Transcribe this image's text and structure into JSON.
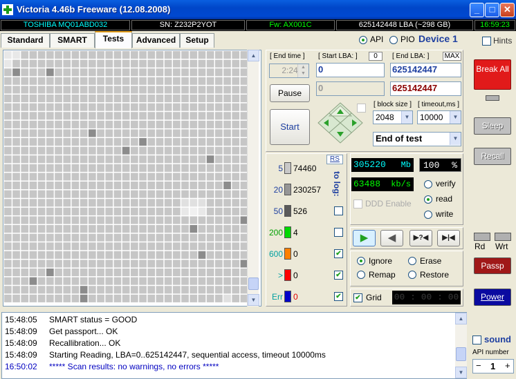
{
  "window": {
    "title": "Victoria 4.46b Freeware (12.08.2008)",
    "controls": {
      "minimize": "_",
      "maximize": "□",
      "close": "✕"
    }
  },
  "infobar": {
    "model": "TOSHIBA MQ01ABD032",
    "serial": "SN: Z232P2YOT",
    "firmware": "Fw: AX001C",
    "capacity": "625142448 LBA (~298 GB)",
    "clock": "16:59:23"
  },
  "tabs": [
    {
      "label": "Standard"
    },
    {
      "label": "SMART"
    },
    {
      "label": "Tests",
      "active": true
    },
    {
      "label": "Advanced"
    },
    {
      "label": "Setup"
    }
  ],
  "mode": {
    "api_label": "API",
    "pio_label": "PIO",
    "api_selected": true,
    "device_label": "Device 1",
    "hints_label": "Hints"
  },
  "test": {
    "end_time_label": "[ End time ]",
    "end_time_value": "2:24",
    "start_lba_label": "[ Start LBA: ]",
    "start_lba_zero": "0",
    "start_lba_value": "0",
    "end_lba_label": "[ End LBA: ]",
    "end_lba_max": "MAX",
    "end_lba_value": "625142447",
    "current_lba_value": "625142447",
    "pause_lba_value": "0",
    "pause_label": "Pause",
    "start_label": "Start",
    "block_size_label": "[ block size ]",
    "block_size_value": "2048",
    "timeout_label": "[ timeout,ms ]",
    "timeout_value": "10000",
    "end_action_value": "End of test"
  },
  "blocks": {
    "rs_label": "RS",
    "to_log_label": "to log:",
    "rows": [
      {
        "threshold": "5",
        "count": "74460",
        "color": "#c8c8c8",
        "log": null
      },
      {
        "threshold": "20",
        "count": "230257",
        "color": "#969696",
        "log": null
      },
      {
        "threshold": "50",
        "count": "526",
        "color": "#5a5a5a",
        "log": false
      },
      {
        "threshold": "200",
        "count": "4",
        "color": "#00d800",
        "log": false
      },
      {
        "threshold": "600",
        "count": "0",
        "color": "#ff8000",
        "log": true
      },
      {
        "threshold": ">",
        "count": "0",
        "color": "#ff0000",
        "log": true
      },
      {
        "threshold": "Err",
        "count": "0",
        "color": "#0000c8",
        "log": true
      }
    ]
  },
  "stats": {
    "mb_value": "305220",
    "mb_unit": "Mb",
    "percent_value": "100",
    "percent_unit": "%",
    "speed_value": "63488",
    "speed_unit": "kb/s",
    "ddd_label": "DDD Enable",
    "verify_label": "verify",
    "read_label": "read",
    "write_label": "write",
    "selected_mode": "read"
  },
  "playback": {
    "play": "▶",
    "back": "◀",
    "skip_unknown": "▶?◀",
    "skip_end": "▶|◀"
  },
  "repair": {
    "ignore_label": "Ignore",
    "erase_label": "Erase",
    "remap_label": "Remap",
    "restore_label": "Restore",
    "selected": "Ignore",
    "grid_label": "Grid",
    "grid_checked": true,
    "timer": "00 : 00 : 00"
  },
  "right": {
    "break_label": "Break All",
    "sleep_label": "Sleep",
    "recall_label": "Recall",
    "rd_label": "Rd",
    "wrt_label": "Wrt",
    "passp_label": "Passp",
    "power_label": "Power",
    "sound_label": "sound",
    "api_number_label": "API number",
    "api_number_value": "1",
    "minus": "−",
    "plus": "+"
  },
  "log": [
    {
      "time": "15:48:05",
      "text": "SMART status = GOOD",
      "color": "#000000"
    },
    {
      "time": "15:48:09",
      "text": "Get passport... OK",
      "color": "#000000"
    },
    {
      "time": "15:48:09",
      "text": "Recallibration... OK",
      "color": "#000000"
    },
    {
      "time": "15:48:09",
      "text": "Starting Reading, LBA=0..625142447, sequential access, timeout 10000ms",
      "color": "#000000"
    },
    {
      "time": "16:50:02",
      "text": "***** Scan results: no warnings, no errors *****",
      "color": "#0000c0"
    }
  ]
}
